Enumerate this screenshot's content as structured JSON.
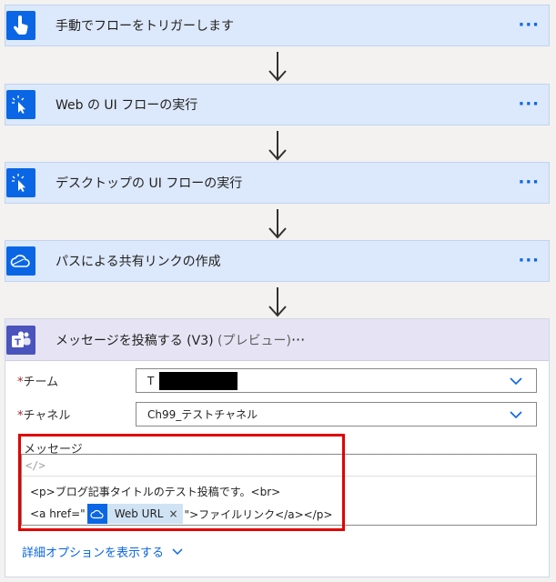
{
  "steps": [
    {
      "title": "手動でフローをトリガーします",
      "icon": "hand-touch-icon",
      "more": "···"
    },
    {
      "title": "Web の UI フローの実行",
      "icon": "cursor-click-icon",
      "more": "···"
    },
    {
      "title": "デスクトップの UI フローの実行",
      "icon": "cursor-click-icon",
      "more": "···"
    },
    {
      "title": "パスによる共有リンクの作成",
      "icon": "onedrive-cloud-icon",
      "more": "···"
    }
  ],
  "teams_action": {
    "title": "メッセージを投稿する (V3)",
    "preview": "(プレビュー)",
    "icon": "teams-icon",
    "more": "···",
    "team_label": "チーム",
    "team_value": "T",
    "channel_label": "チャネル",
    "channel_value": "Ch99_テストチャネル",
    "required_mark": "*",
    "message_label": "メッセージ",
    "code_toggle": "</>",
    "message_line1": "<p>ブログ記事タイトルのテスト投稿です。<br>",
    "message_line2_prefix": "<a href=\"",
    "token_label": "Web URL",
    "token_close": "×",
    "message_line2_suffix": "\">ファイルリンク</a></p>",
    "advanced_options": "詳細オプションを表示する"
  },
  "colors": {
    "accent": "#0a66e4",
    "card_bg": "#dce8fb",
    "teams_purple": "#4b53bc",
    "highlight": "#e00000"
  }
}
